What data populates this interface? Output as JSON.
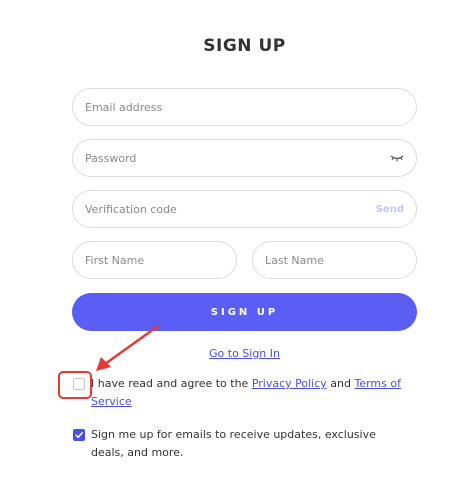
{
  "page": {
    "title": "SIGN UP"
  },
  "form": {
    "email": {
      "placeholder": "Email address",
      "value": ""
    },
    "password": {
      "placeholder": "Password",
      "value": "",
      "toggle_icon": "eye-closed-icon"
    },
    "verification": {
      "placeholder": "Verification code",
      "value": "",
      "send_label": "Send"
    },
    "first_name": {
      "placeholder": "First Name",
      "value": ""
    },
    "last_name": {
      "placeholder": "Last Name",
      "value": ""
    },
    "submit_label": "SIGN UP",
    "signin_link": "Go to Sign In"
  },
  "consent": {
    "agree": {
      "checked": false,
      "text_before": "I have read and agree to the ",
      "privacy_link": "Privacy Policy",
      "text_middle": " and ",
      "terms_link": "Terms of Service"
    },
    "emails": {
      "checked": true,
      "text": "Sign me up for emails to receive updates, exclusive deals, and more."
    }
  },
  "annotation": {
    "highlight_color": "#e53935",
    "target": "agree-checkbox"
  },
  "colors": {
    "accent": "#5b5ef5",
    "link": "#4a4fe0",
    "send_disabled": "#c3c6f5",
    "border": "#dcdcdc"
  }
}
